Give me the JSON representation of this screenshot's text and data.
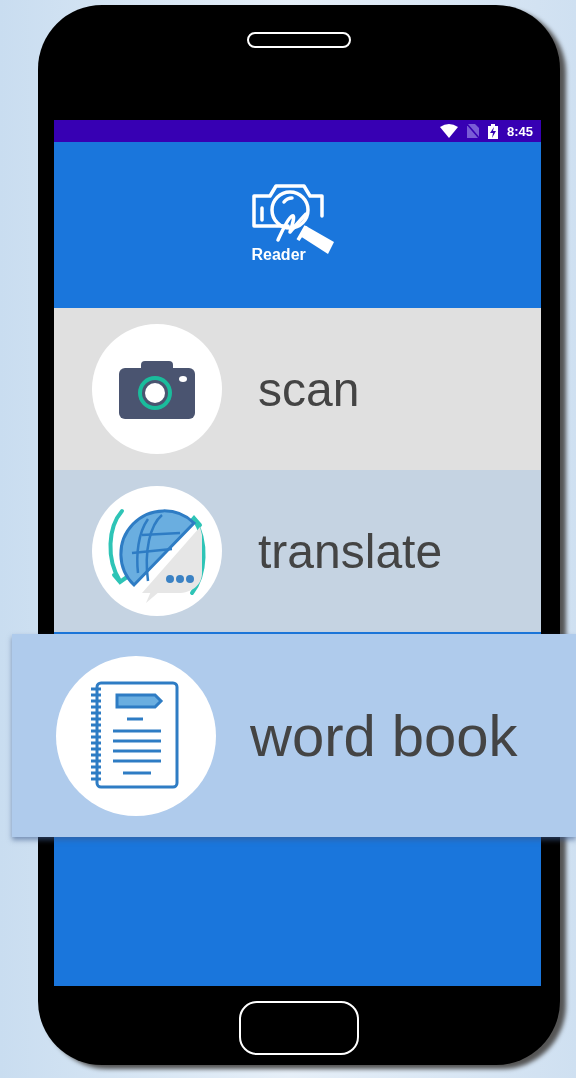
{
  "status_bar": {
    "time": "8:45"
  },
  "header": {
    "logo_text": "Reader"
  },
  "menu": [
    {
      "label": "scan",
      "selected": false
    },
    {
      "label": "translate",
      "selected": false
    },
    {
      "label": "word book",
      "selected": true
    }
  ]
}
